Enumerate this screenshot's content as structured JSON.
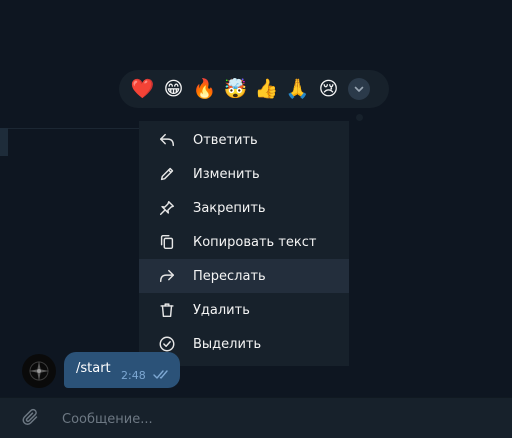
{
  "reactions": [
    "❤️",
    "😁",
    "🔥",
    "🤯",
    "👍",
    "🙏",
    "😢"
  ],
  "menu": {
    "items": [
      {
        "label": "Ответить",
        "icon": "reply-icon"
      },
      {
        "label": "Изменить",
        "icon": "pencil-icon"
      },
      {
        "label": "Закрепить",
        "icon": "pin-icon"
      },
      {
        "label": "Копировать текст",
        "icon": "copy-icon"
      },
      {
        "label": "Переслать",
        "icon": "forward-icon"
      },
      {
        "label": "Удалить",
        "icon": "trash-icon"
      },
      {
        "label": "Выделить",
        "icon": "check-circle-icon"
      }
    ]
  },
  "message": {
    "text": "/start",
    "time": "2:48"
  },
  "input": {
    "placeholder": "Сообщение..."
  },
  "colors": {
    "background": "#0e1621",
    "panel": "#17212b",
    "bubble": "#2b5278",
    "hover": "#232e3c"
  }
}
